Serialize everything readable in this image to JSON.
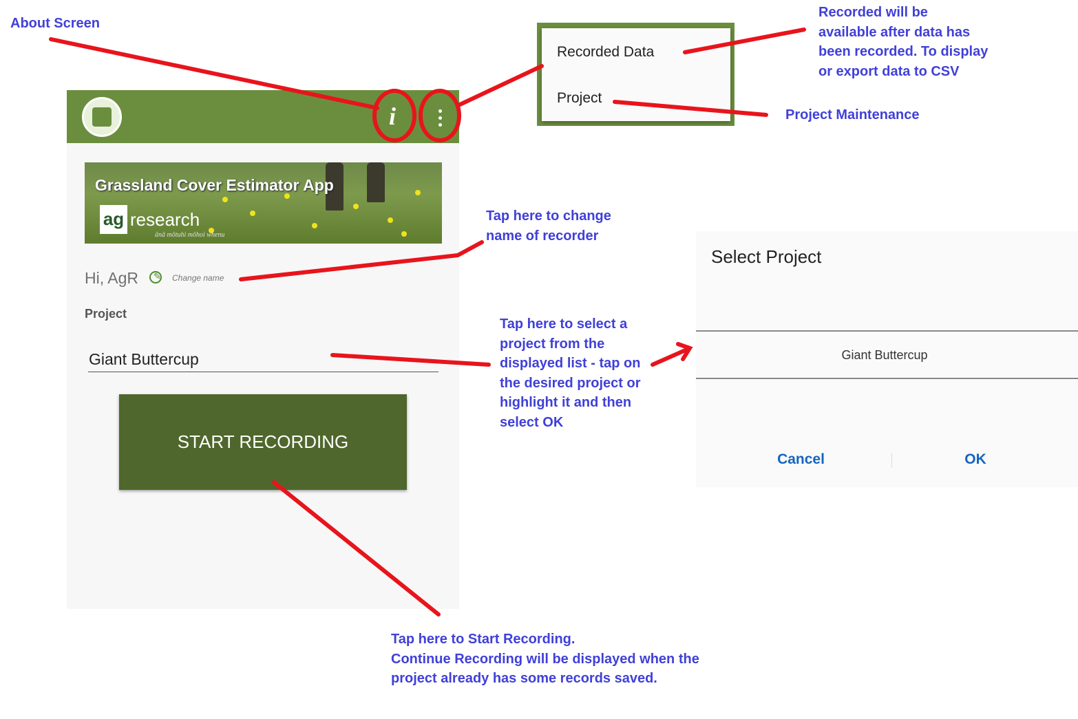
{
  "annotations": {
    "about_screen": "About Screen",
    "recorded_note": [
      "Recorded will be",
      "available after data has",
      "been recorded. To display",
      "or export data to CSV"
    ],
    "project_maintenance": "Project Maintenance",
    "change_name_note": [
      "Tap here to change",
      "name of recorder"
    ],
    "select_project_note": [
      "Tap here to select a",
      "project from the",
      "displayed list - tap on",
      "the desired project or",
      "highlight it and then",
      "select OK"
    ],
    "start_recording_note": [
      "Tap here to Start Recording.",
      "Continue Recording will be displayed when the",
      "project already has  some records saved."
    ]
  },
  "app": {
    "appbar": {
      "logo_icon": "app-logo-icon",
      "info_icon": "info-icon",
      "more_icon": "more-vert-icon",
      "color": "#6b8e3e"
    },
    "banner": {
      "title": "Grassland Cover Estimator App",
      "logo_part1": "ag",
      "logo_part2": "research",
      "tagline": "ānā mōtuhi mōhoi whenu"
    },
    "greeting": "Hi, AgR",
    "change_name_label": "Change name",
    "project_label": "Project",
    "project_value": "Giant Buttercup",
    "start_button": "START RECORDING",
    "button_color": "#4f672c"
  },
  "menu": {
    "items": [
      "Recorded Data",
      "Project"
    ]
  },
  "dialog": {
    "title": "Select Project",
    "options": [
      "Giant Buttercup"
    ],
    "cancel": "Cancel",
    "ok": "OK",
    "accent": "#1565c0"
  },
  "colors": {
    "annotation_text": "#4040d8",
    "arrow": "#e8141c"
  }
}
